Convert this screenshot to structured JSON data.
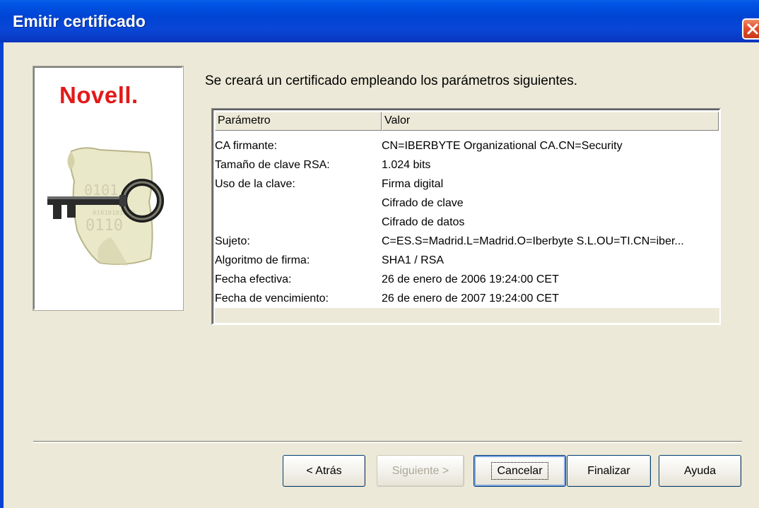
{
  "window": {
    "title": "Emitir certificado"
  },
  "logo": {
    "brand": "Novell."
  },
  "intro_text": "Se creará un certificado empleando los parámetros siguientes.",
  "table": {
    "columns": [
      "Parámetro",
      "Valor"
    ],
    "rows": [
      {
        "param": "CA firmante:",
        "value": "CN=IBERBYTE Organizational CA.CN=Security"
      },
      {
        "param": "Tamaño de clave RSA:",
        "value": "1.024 bits"
      },
      {
        "param": "Uso de la clave:",
        "value": "Firma digital"
      },
      {
        "param": "",
        "value": "Cifrado de clave"
      },
      {
        "param": "",
        "value": "Cifrado de datos"
      },
      {
        "param": "Sujeto:",
        "value": "C=ES.S=Madrid.L=Madrid.O=Iberbyte S.L.OU=TI.CN=iber..."
      },
      {
        "param": "Algoritmo de firma:",
        "value": "SHA1 / RSA"
      },
      {
        "param": "Fecha efectiva:",
        "value": "26 de enero de 2006 19:24:00 CET"
      },
      {
        "param": "Fecha de vencimiento:",
        "value": "26 de enero de 2007 19:24:00 CET"
      }
    ]
  },
  "buttons": {
    "back": "< Atrás",
    "next": "Siguiente >",
    "cancel": "Cancelar",
    "finish": "Finalizar",
    "help": "Ayuda"
  },
  "colors": {
    "titlebar": "#0044d4",
    "dialog_bg": "#ece9d8",
    "brand_red": "#e11a1a",
    "close_button": "#e0502c"
  },
  "icons": {
    "close": "close-icon",
    "key_certificate": "key-certificate-icon"
  }
}
